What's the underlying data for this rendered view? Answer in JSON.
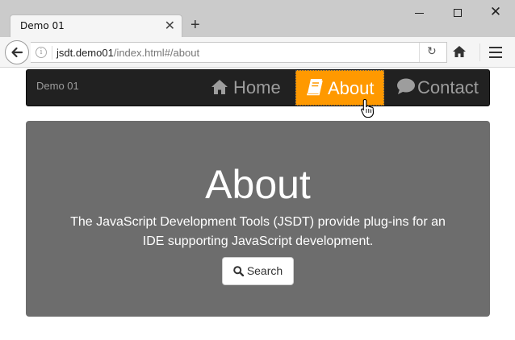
{
  "browser": {
    "tab_title": "Demo 01",
    "tab_close": "✕",
    "new_tab": "+",
    "window_close": "✕",
    "url_host": "jsdt.demo01",
    "url_path": "/index.html#/about",
    "reload_glyph": "↻",
    "info_glyph": "i"
  },
  "site": {
    "brand": "Demo 01",
    "nav": {
      "home": {
        "label": "Home",
        "icon": "home-icon"
      },
      "about": {
        "label": "About",
        "icon": "book-icon",
        "active": true,
        "active_color": "#ff9900"
      },
      "contact": {
        "label": "Contact",
        "icon": "comment-icon"
      }
    },
    "jumbotron": {
      "title": "About",
      "text": "The JavaScript Development Tools (JSDT) provide plug-ins for an IDE supporting JavaScript development.",
      "button_label": "Search",
      "button_icon": "search-icon"
    }
  },
  "colors": {
    "navbar_bg": "#212121",
    "accent": "#ff9900",
    "jumbotron_bg": "#6d6d6d"
  }
}
